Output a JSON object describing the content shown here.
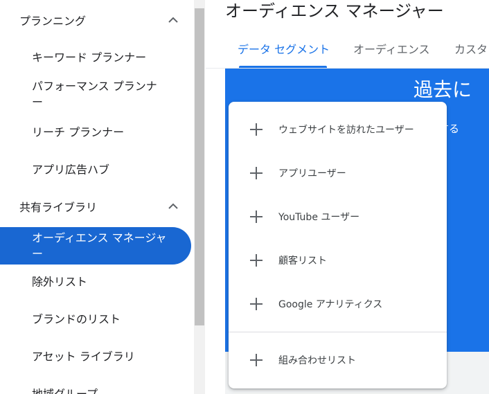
{
  "sidebar": {
    "sections": [
      {
        "title": "プランニング",
        "items": [
          {
            "label": "キーワード プランナー"
          },
          {
            "label": "パフォーマンス プランナー"
          },
          {
            "label": "リーチ プランナー"
          },
          {
            "label": "アプリ広告ハブ"
          }
        ]
      },
      {
        "title": "共有ライブラリ",
        "items": [
          {
            "label": "オーディエンス マネージャー"
          },
          {
            "label": "除外リスト"
          },
          {
            "label": "ブランドのリスト"
          },
          {
            "label": "アセット ライブラリ"
          },
          {
            "label": "地域グループ"
          }
        ]
      }
    ],
    "active_item": "オーディエンス マネージャー"
  },
  "main": {
    "title": "オーディエンス マネージャー",
    "tabs": [
      {
        "label": "データ セグメント",
        "active": true
      },
      {
        "label": "オーディエンス",
        "active": false
      },
      {
        "label": "カスタ",
        "active": false
      }
    ],
    "panel": {
      "heading_fragment": "過去に",
      "sub_fragment": "使用する"
    }
  },
  "menu": {
    "items": [
      {
        "label": "ウェブサイトを訪れたユーザー",
        "icon": "plus-icon"
      },
      {
        "label": "アプリユーザー",
        "icon": "plus-icon"
      },
      {
        "label": "YouTube ユーザー",
        "icon": "plus-icon"
      },
      {
        "label": "顧客リスト",
        "icon": "plus-icon"
      },
      {
        "label": "Google アナリティクス",
        "icon": "plus-icon"
      },
      {
        "label": "組み合わせリスト",
        "icon": "plus-icon"
      }
    ]
  },
  "colors": {
    "accent": "#1a73e8",
    "active_nav": "#1967d2",
    "panel": "#1a73e8",
    "text": "#3c4043"
  }
}
